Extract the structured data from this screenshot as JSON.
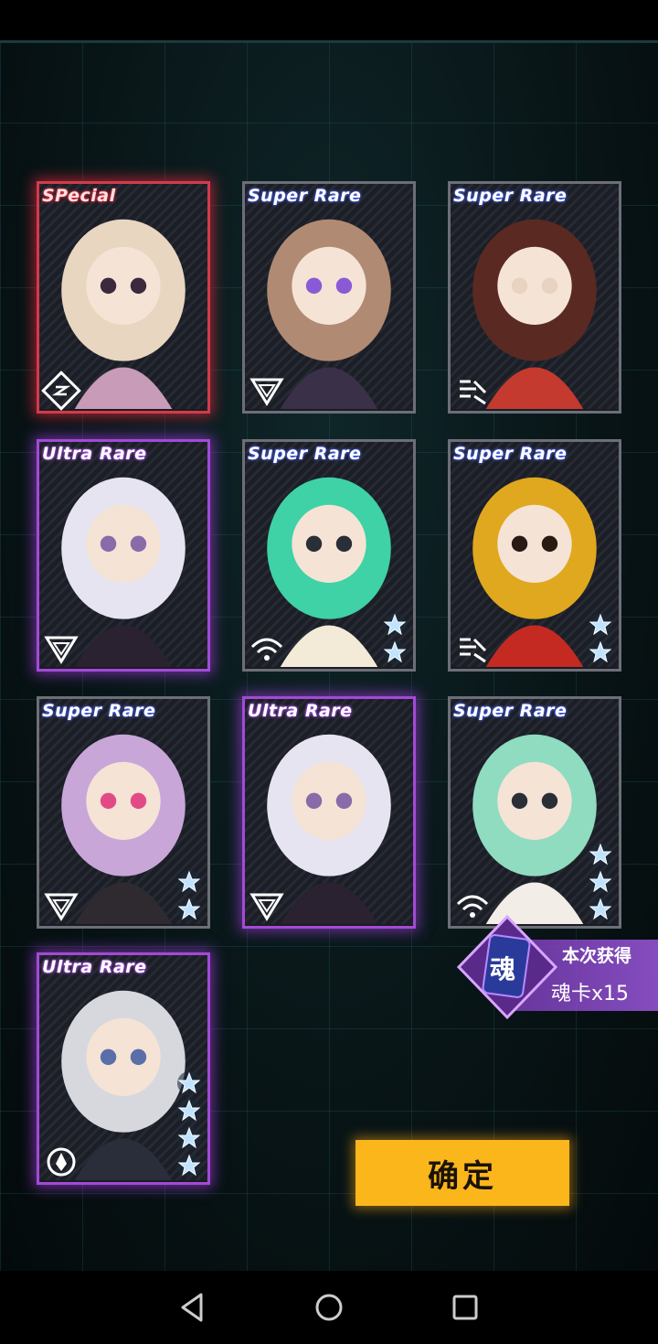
{
  "cards": [
    {
      "rarity": "SPecial",
      "tier": "special",
      "faction": "seal-glyph-icon",
      "stars": 0,
      "art": "blonde-girl-portrait"
    },
    {
      "rarity": "Super Rare",
      "tier": "super",
      "faction": "triangle-emblem-icon",
      "stars": 0,
      "art": "brown-hair-girl-portrait"
    },
    {
      "rarity": "Super Rare",
      "tier": "super",
      "faction": "stripes-emblem-icon",
      "stars": 0,
      "art": "red-cap-girl-portrait"
    },
    {
      "rarity": "Ultra Rare",
      "tier": "ultra",
      "faction": "triangle-emblem-icon",
      "stars": 0,
      "art": "white-hair-girl-portrait"
    },
    {
      "rarity": "Super Rare",
      "tier": "super",
      "faction": "wifi-emblem-icon",
      "stars": 2,
      "art": "chibi-green-hat-portrait"
    },
    {
      "rarity": "Super Rare",
      "tier": "super",
      "faction": "stripes-emblem-icon",
      "stars": 2,
      "art": "skull-lantern-portrait"
    },
    {
      "rarity": "Super Rare",
      "tier": "super",
      "faction": "triangle-emblem-icon",
      "stars": 2,
      "art": "chibi-purple-hair-portrait"
    },
    {
      "rarity": "Ultra Rare",
      "tier": "ultra",
      "faction": "triangle-emblem-icon",
      "stars": 0,
      "art": "white-hair-girl-portrait"
    },
    {
      "rarity": "Super Rare",
      "tier": "super",
      "faction": "wifi-emblem-icon",
      "stars": 3,
      "art": "chibi-green-hair-portrait"
    },
    {
      "rarity": "Ultra Rare",
      "tier": "ultra",
      "faction": "ring-emblem-icon",
      "stars": 4,
      "art": "robot-portrait"
    }
  ],
  "soul_reward": {
    "gem_label": "魂",
    "title": "本次获得",
    "value": "魂卡x15"
  },
  "confirm_label": "确定",
  "colors": {
    "accent": "#fbb61b",
    "special": "#d23b4b",
    "ultra": "#a34ad6",
    "star": "#bfe3ff"
  }
}
